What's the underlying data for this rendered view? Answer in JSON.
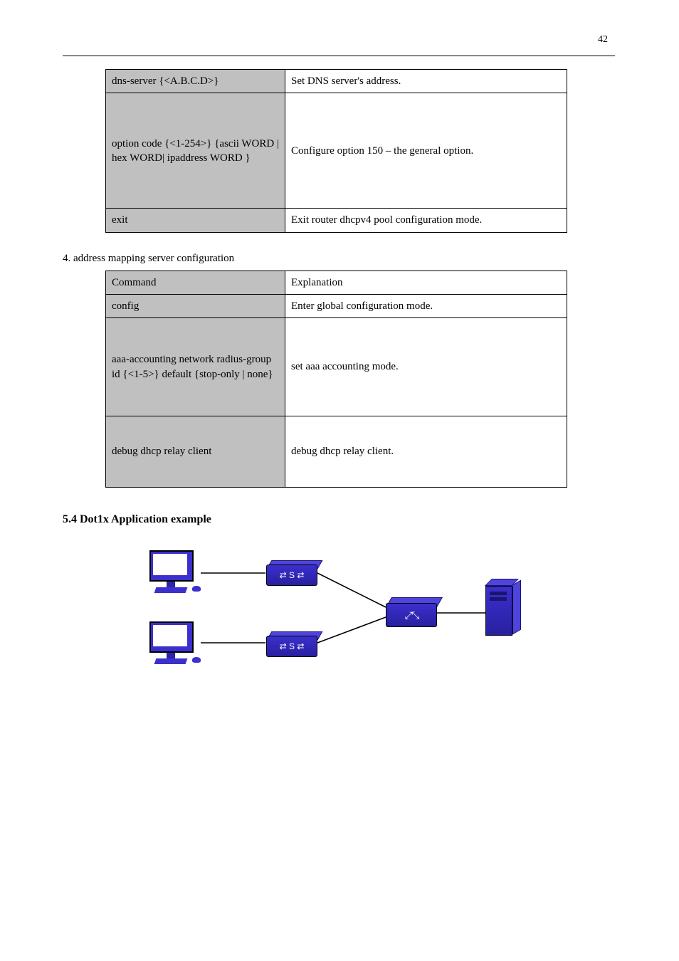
{
  "header": {
    "page": "42"
  },
  "tableA": {
    "rows": [
      {
        "left": "dns-server {<A.B.C.D>}",
        "right": "Set DNS server's address."
      },
      {
        "left": "option code {<1-254>} {ascii WORD | hex WORD| ipaddress WORD }",
        "right": "Configure option 150 – the general option."
      },
      {
        "left": "exit",
        "right": "Exit router dhcpv4 pool configuration mode."
      }
    ]
  },
  "section_label": "4. address mapping server configuration",
  "tableB": {
    "header": {
      "left": "Command",
      "right": "Explanation"
    },
    "rows": [
      {
        "left": "config",
        "right": "Enter global configuration mode."
      },
      {
        "left": "aaa-accounting network radius-group id {<1-5>} default {stop-only | none}",
        "right": "set aaa accounting mode."
      },
      {
        "left": "debug dhcp relay client",
        "right": "debug dhcp relay client."
      }
    ]
  },
  "heading": "5.4 Dot1x Application example",
  "diagram": {
    "nodes": [
      "pc1",
      "pc2",
      "switch1",
      "switch2",
      "router",
      "server"
    ],
    "edges": [
      [
        "pc1",
        "switch1"
      ],
      [
        "pc2",
        "switch2"
      ],
      [
        "switch1",
        "router"
      ],
      [
        "switch2",
        "router"
      ],
      [
        "router",
        "server"
      ]
    ]
  }
}
